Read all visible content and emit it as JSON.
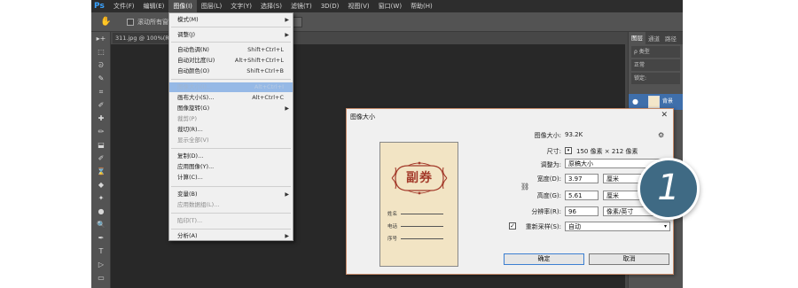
{
  "app": {
    "logo": "Ps",
    "menu": [
      "文件(F)",
      "编辑(E)",
      "图像(I)",
      "图层(L)",
      "文字(Y)",
      "选择(S)",
      "滤镜(T)",
      "3D(D)",
      "视图(V)",
      "窗口(W)",
      "帮助(H)"
    ],
    "options_label": "滚动所有窗口",
    "doc_tab": "311.jpg @ 100%(RGB/8)"
  },
  "toolbox": {
    "tools": [
      "▸+",
      "⬚",
      "ᘐ",
      "✎",
      "⌗",
      "✐",
      "✚",
      "✏",
      "⬓",
      "✐",
      "⌛",
      "◆",
      "✦",
      "●",
      "🔍",
      "✒",
      "T",
      "▷",
      "▭"
    ]
  },
  "right_panel": {
    "tabs": [
      "图层",
      "通道",
      "路径"
    ],
    "search_label": "ρ 类型",
    "blend_mode": "正常",
    "lock_label": "锁定:",
    "layer_name": "背景"
  },
  "image_menu": {
    "items": [
      {
        "label": "模式(M)",
        "shortcut": "",
        "submenu": true,
        "disabled": false
      },
      {
        "label": "调整(J)",
        "shortcut": "",
        "submenu": true,
        "disabled": false
      },
      {
        "label": "自动色调(N)",
        "shortcut": "Shift+Ctrl+L",
        "submenu": false,
        "disabled": false
      },
      {
        "label": "自动对比度(U)",
        "shortcut": "Alt+Shift+Ctrl+L",
        "submenu": false,
        "disabled": false
      },
      {
        "label": "自动颜色(O)",
        "shortcut": "Shift+Ctrl+B",
        "submenu": false,
        "disabled": false
      },
      {
        "label": "图像大小(I)...",
        "shortcut": "Alt+Ctrl+I",
        "submenu": false,
        "disabled": false,
        "highlight": true
      },
      {
        "label": "画布大小(S)...",
        "shortcut": "Alt+Ctrl+C",
        "submenu": false,
        "disabled": false
      },
      {
        "label": "图像旋转(G)",
        "shortcut": "",
        "submenu": true,
        "disabled": false
      },
      {
        "label": "裁剪(P)",
        "shortcut": "",
        "submenu": false,
        "disabled": true
      },
      {
        "label": "裁切(R)...",
        "shortcut": "",
        "submenu": false,
        "disabled": false
      },
      {
        "label": "显示全部(V)",
        "shortcut": "",
        "submenu": false,
        "disabled": true
      },
      {
        "label": "复制(D)...",
        "shortcut": "",
        "submenu": false,
        "disabled": false
      },
      {
        "label": "应用图像(Y)...",
        "shortcut": "",
        "submenu": false,
        "disabled": false
      },
      {
        "label": "计算(C)...",
        "shortcut": "",
        "submenu": false,
        "disabled": false
      },
      {
        "label": "变量(B)",
        "shortcut": "",
        "submenu": true,
        "disabled": false
      },
      {
        "label": "应用数据组(L)...",
        "shortcut": "",
        "submenu": false,
        "disabled": true
      },
      {
        "label": "陷印(T)...",
        "shortcut": "",
        "submenu": false,
        "disabled": true
      },
      {
        "label": "分析(A)",
        "shortcut": "",
        "submenu": true,
        "disabled": false
      }
    ]
  },
  "dialog": {
    "title": "图像大小",
    "preview": {
      "title": "副券",
      "fields": [
        "姓名",
        "电话",
        "序号"
      ]
    },
    "image_size_label": "图像大小:",
    "image_size_value": "93.2K",
    "dimensions_label": "尺寸:",
    "dimensions_value": "150 像素 × 212 像素",
    "fit_to_label": "调整为:",
    "fit_to_value": "原稿大小",
    "width_label": "宽度(D):",
    "width_value": "3.97",
    "width_unit": "厘米",
    "height_label": "高度(G):",
    "height_value": "5.61",
    "height_unit": "厘米",
    "resolution_label": "分辨率(R):",
    "resolution_value": "96",
    "resolution_unit": "像素/英寸",
    "resample_label": "重新采样(S):",
    "resample_checked": true,
    "resample_value": "自动",
    "ok_label": "确定",
    "cancel_label": "取消"
  },
  "badge": {
    "number": "1",
    "color": "#3f6a84"
  }
}
